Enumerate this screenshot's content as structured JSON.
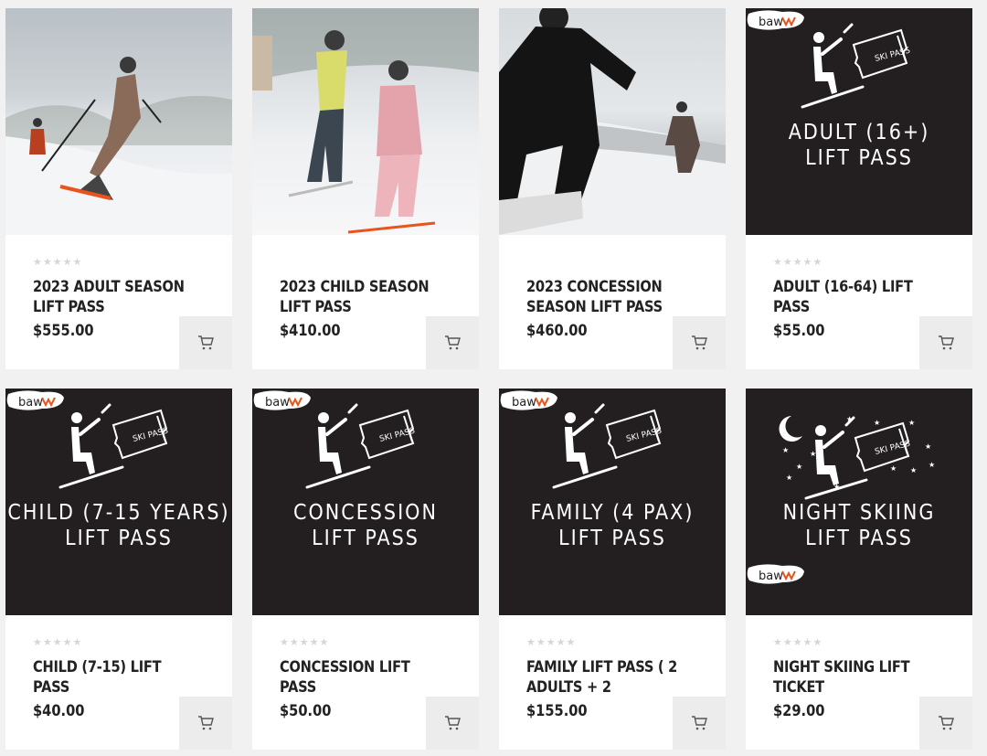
{
  "products": [
    {
      "title": "2023 ADULT SEASON LIFT PASS",
      "price": "$555.00",
      "image": "skier-photo",
      "stars": "★★★★★"
    },
    {
      "title": "2023 CHILD SEASON LIFT PASS",
      "price": "$410.00",
      "image": "child-skier-photo",
      "stars": ""
    },
    {
      "title": "2023 CONCESSION SEASON LIFT PASS",
      "price": "$460.00",
      "image": "snowboarder-photo",
      "stars": ""
    },
    {
      "title": "ADULT (16-64) LIFT PASS",
      "price": "$55.00",
      "image": "pass-graphic",
      "stars": "★★★★★",
      "graphic": {
        "line1": "ADULT (16+)",
        "line2": "LIFT PASS",
        "ticket": "SKI PASS",
        "logo": "baw"
      }
    },
    {
      "title": "CHILD (7-15) LIFT PASS",
      "price": "$40.00",
      "image": "pass-graphic",
      "stars": "★★★★★",
      "graphic": {
        "line1": "CHILD (7-15 YEARS)",
        "line2": "LIFT PASS",
        "ticket": "SKI PASS",
        "logo": "baw"
      }
    },
    {
      "title": "CONCESSION LIFT PASS",
      "price": "$50.00",
      "image": "pass-graphic",
      "stars": "★★★★★",
      "graphic": {
        "line1": "CONCESSION",
        "line2": "LIFT PASS",
        "ticket": "SKI PASS",
        "logo": "baw"
      }
    },
    {
      "title": "FAMILY LIFT PASS ( 2 ADULTS + 2",
      "price": "$155.00",
      "image": "pass-graphic",
      "stars": "★★★★★",
      "graphic": {
        "line1": "FAMILY (4 PAX)",
        "line2": "LIFT PASS",
        "ticket": "SKI PASS",
        "logo": "baw"
      }
    },
    {
      "title": "NIGHT SKIING LIFT TICKET",
      "price": "$29.00",
      "image": "night-pass-graphic",
      "stars": "★★★★★",
      "graphic": {
        "line1": "NIGHT SKIING",
        "line2": "LIFT PASS",
        "ticket": "SKI PASS",
        "logo": "baw"
      }
    }
  ],
  "icons": {
    "cart": "cart-icon",
    "rating": "star-rating"
  },
  "colors": {
    "dark_tile": "#231f20",
    "cart_bg": "#ececec",
    "logo_accent": "#e8541d"
  }
}
